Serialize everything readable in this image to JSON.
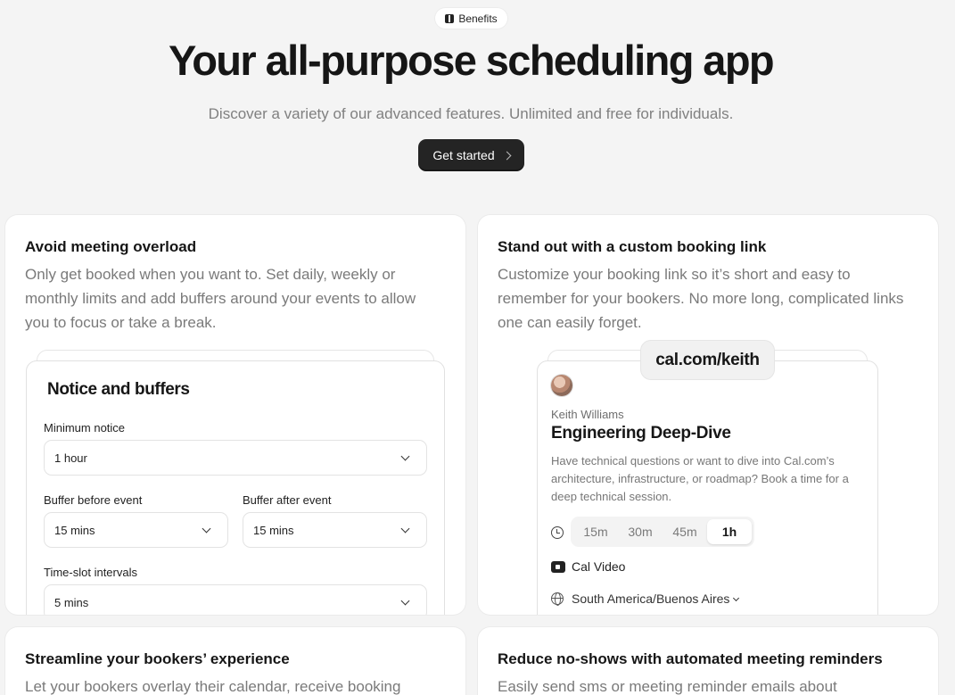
{
  "hero": {
    "badge_label": "Benefits",
    "badge_icon": "gift-icon",
    "title": "Your all-purpose scheduling app",
    "subtitle": "Discover a variety of our advanced features. Unlimited and free for individuals.",
    "cta_label": "Get started",
    "cta_icon": "chevron-right-icon"
  },
  "cards": [
    {
      "title": "Avoid meeting overload",
      "description": "Only get booked when you want to. Set daily, weekly or monthly limits and add buffers around your events to allow you to focus or take a break."
    },
    {
      "title": "Stand out with a custom booking link",
      "description": "Customize your booking link so it’s short and easy to remember for your bookers. No more long, complicated links one can easily forget."
    },
    {
      "title": "Streamline your bookers’ experience",
      "description": "Let your bookers overlay their calendar, receive booking"
    },
    {
      "title": "Reduce no-shows with automated meeting reminders",
      "description": "Easily send sms or meeting reminder emails about"
    }
  ],
  "notice": {
    "title": "Notice and buffers",
    "minimum_notice_label": "Minimum notice",
    "minimum_notice_value": "1 hour",
    "buffer_before_label": "Buffer before event",
    "buffer_before_value": "15 mins",
    "buffer_after_label": "Buffer after event",
    "buffer_after_value": "15 mins",
    "interval_label": "Time-slot intervals",
    "interval_value": "5 mins"
  },
  "booking": {
    "url": "cal.com/keith",
    "host": "Keith Williams",
    "event": "Engineering Deep-Dive",
    "description": "Have technical questions or want to dive into Cal.com’s architecture, infrastructure, or roadmap? Book a time for a deep technical session.",
    "durations": [
      "15m",
      "30m",
      "45m",
      "1h"
    ],
    "selected_duration": "1h",
    "location": "Cal Video",
    "timezone": "South America/Buenos Aires"
  },
  "colors": {
    "background": "#f4f4f4",
    "card": "#ffffff",
    "cta": "#242424",
    "text_muted": "#7a7a7a"
  }
}
